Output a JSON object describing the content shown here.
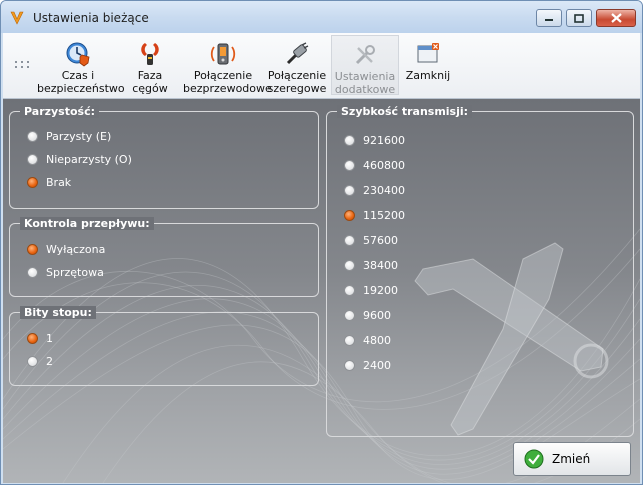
{
  "window": {
    "title": "Ustawienia bieżące"
  },
  "toolbar": {
    "items": [
      {
        "label": "Czas i\nbezpieczeństwo",
        "icon": "clock-shield-icon",
        "enabled": true
      },
      {
        "label": "Faza\ncęgów",
        "icon": "clamp-phase-icon",
        "enabled": true
      },
      {
        "label": "Połączenie\nbezprzewodowe",
        "icon": "wireless-icon",
        "enabled": true
      },
      {
        "label": "Połączenie\nszeregowe",
        "icon": "serial-cable-icon",
        "enabled": true
      },
      {
        "label": "Ustawienia\ndodatkowe",
        "icon": "tools-icon",
        "enabled": false,
        "active": true
      },
      {
        "label": "Zamknij",
        "icon": "close-window-icon",
        "enabled": true
      }
    ]
  },
  "parity": {
    "title": "Parzystość:",
    "options": [
      "Parzysty (E)",
      "Nieparzysty (O)",
      "Brak"
    ],
    "selected": 2
  },
  "flow": {
    "title": "Kontrola przepływu:",
    "options": [
      "Wyłączona",
      "Sprzętowa"
    ],
    "selected": 0
  },
  "stopbits": {
    "title": "Bity stopu:",
    "options": [
      "1",
      "2"
    ],
    "selected": 0
  },
  "baud": {
    "title": "Szybkość transmisji:",
    "options": [
      "921600",
      "460800",
      "230400",
      "115200",
      "57600",
      "38400",
      "19200",
      "9600",
      "4800",
      "2400"
    ],
    "selected": 3
  },
  "apply_button": {
    "label": "Zmień"
  },
  "colors": {
    "accent_radio": "#e8630f",
    "title_bar": "#c9dbf0",
    "panel_bg": "#7f8287"
  }
}
